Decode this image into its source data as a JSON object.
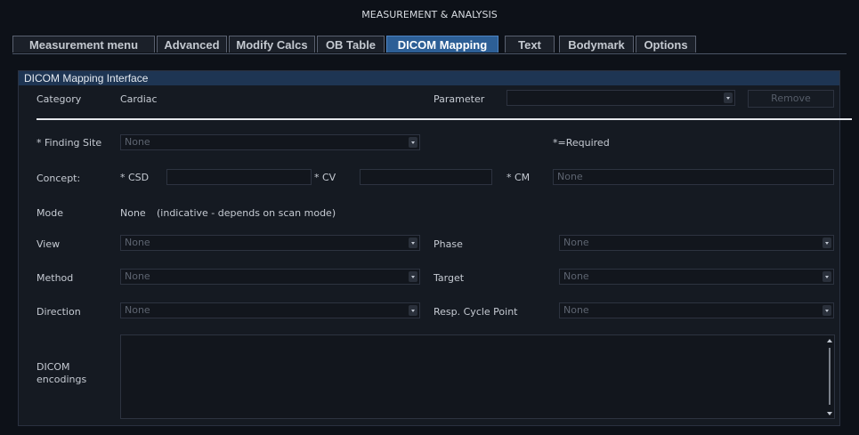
{
  "window": {
    "title": "MEASUREMENT & ANALYSIS"
  },
  "tabs": [
    {
      "label": "Measurement menu"
    },
    {
      "label": "Advanced"
    },
    {
      "label": "Modify Calcs"
    },
    {
      "label": "OB Table"
    },
    {
      "label": "DICOM Mapping",
      "active": true
    },
    {
      "label": "Text"
    },
    {
      "label": "Bodymark"
    },
    {
      "label": "Options"
    }
  ],
  "panel": {
    "title": "DICOM Mapping Interface",
    "category": {
      "label": "Category",
      "value": "Cardiac"
    },
    "parameter": {
      "label": "Parameter",
      "value": ""
    },
    "remove_label": "Remove",
    "finding_site": {
      "label": "* Finding Site",
      "value": "None"
    },
    "required_note": "*=Required",
    "concept": {
      "label": "Concept:",
      "csd_label": "* CSD",
      "csd_value": "",
      "cv_label": "* CV",
      "cv_value": "",
      "cm_label": "* CM",
      "cm_value": "None"
    },
    "mode": {
      "label": "Mode",
      "value": "None",
      "note": "(indicative - depends on scan mode)"
    },
    "view": {
      "label": "View",
      "value": "None"
    },
    "phase": {
      "label": "Phase",
      "value": "None"
    },
    "method": {
      "label": "Method",
      "value": "None"
    },
    "target": {
      "label": "Target",
      "value": "None"
    },
    "direction": {
      "label": "Direction",
      "value": "None"
    },
    "resp_cycle_point": {
      "label": "Resp. Cycle Point",
      "value": "None"
    },
    "encodings": {
      "label_line1": "DICOM",
      "label_line2": "encodings",
      "value": ""
    }
  },
  "colors": {
    "background": "#0d1118",
    "tab_active": "#2d5f96",
    "panel_header": "#1e3553"
  }
}
